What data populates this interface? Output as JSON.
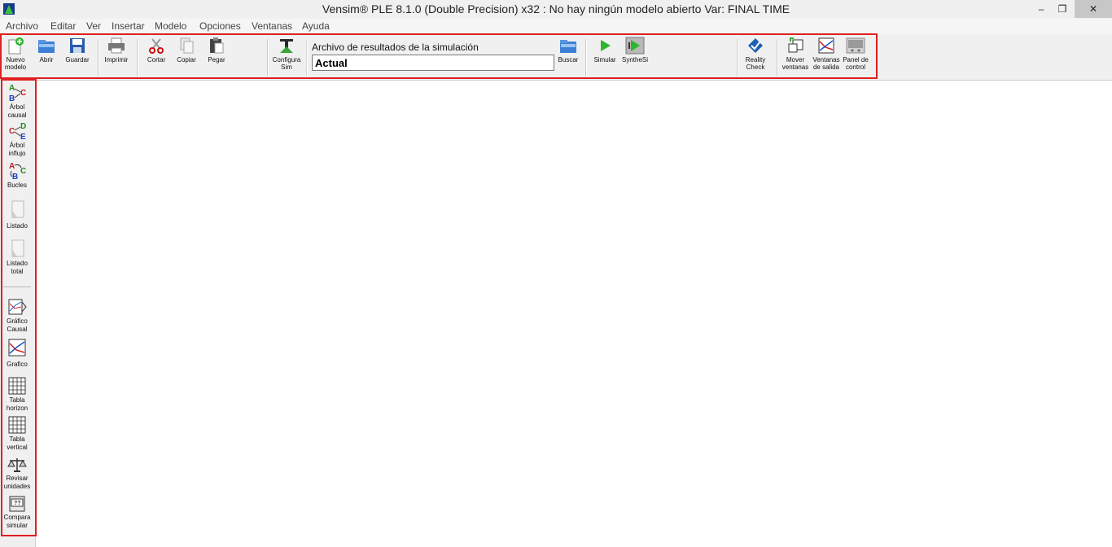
{
  "window": {
    "title": "Vensim® PLE 8.1.0 (Double Precision) x32 : No hay ningún modelo abierto Var: FINAL TIME",
    "minimize": "–",
    "restore": "❐",
    "close": "✕"
  },
  "menu": [
    "Archivo",
    "Editar",
    "Ver",
    "Insertar",
    "Modelo",
    "Opciones",
    "Ventanas",
    "Ayuda"
  ],
  "toolbar": {
    "nuevo": [
      "Nuevo",
      "modelo"
    ],
    "abrir": "Abrir",
    "guardar": "Guardar",
    "imprimir": "Imprimir",
    "cortar": "Cortar",
    "copiar": "Copiar",
    "pegar": "Pegar",
    "configura": [
      "Configura",
      "Sim"
    ],
    "results_label": "Archivo de resultados de la simulación",
    "results_value": "Actual",
    "buscar": "Buscar",
    "simular": "Simular",
    "synthesim": "SyntheSi",
    "reality": [
      "Reality",
      "Check"
    ],
    "mover": [
      "Mover",
      "ventanas"
    ],
    "ventanas": [
      "Ventanas",
      "de salida"
    ],
    "panel": [
      "Panel de",
      "control"
    ]
  },
  "left": {
    "arbol_causal": [
      "Árbol",
      "causal"
    ],
    "arbol_influjo": [
      "Árbol",
      "influjo"
    ],
    "bucles": "Bucles",
    "listado": "Listado",
    "listado_total": [
      "Listado",
      "total"
    ],
    "grafico_causal": [
      "Gráfico",
      "Causal"
    ],
    "grafico": "Grafico",
    "tabla_horizon": [
      "Tabla",
      "horizon"
    ],
    "tabla_vertical": [
      "Tabla",
      "vertical"
    ],
    "revisar": [
      "Revisar",
      "unidades"
    ],
    "compara": [
      "Compara",
      "simular"
    ]
  },
  "colors": {
    "highlight": "#e02020",
    "toolbar_bg": "#f0f0f0"
  }
}
